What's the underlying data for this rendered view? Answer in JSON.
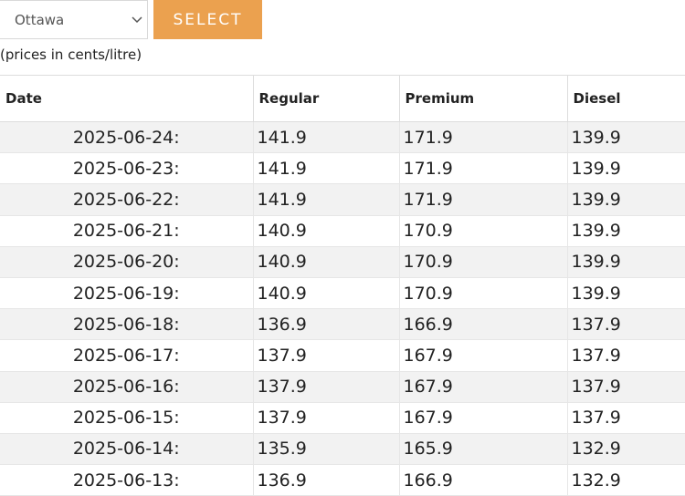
{
  "selector": {
    "city_value": "Ottawa",
    "button_label": "SELECT"
  },
  "note": "(prices in cents/litre)",
  "table": {
    "headers": {
      "date": "Date",
      "regular": "Regular",
      "premium": "Premium",
      "diesel": "Diesel"
    },
    "rows": [
      {
        "date": "2025-06-24:",
        "regular": "141.9",
        "premium": "171.9",
        "diesel": "139.9"
      },
      {
        "date": "2025-06-23:",
        "regular": "141.9",
        "premium": "171.9",
        "diesel": "139.9"
      },
      {
        "date": "2025-06-22:",
        "regular": "141.9",
        "premium": "171.9",
        "diesel": "139.9"
      },
      {
        "date": "2025-06-21:",
        "regular": "140.9",
        "premium": "170.9",
        "diesel": "139.9"
      },
      {
        "date": "2025-06-20:",
        "regular": "140.9",
        "premium": "170.9",
        "diesel": "139.9"
      },
      {
        "date": "2025-06-19:",
        "regular": "140.9",
        "premium": "170.9",
        "diesel": "139.9"
      },
      {
        "date": "2025-06-18:",
        "regular": "136.9",
        "premium": "166.9",
        "diesel": "137.9"
      },
      {
        "date": "2025-06-17:",
        "regular": "137.9",
        "premium": "167.9",
        "diesel": "137.9"
      },
      {
        "date": "2025-06-16:",
        "regular": "137.9",
        "premium": "167.9",
        "diesel": "137.9"
      },
      {
        "date": "2025-06-15:",
        "regular": "137.9",
        "premium": "167.9",
        "diesel": "137.9"
      },
      {
        "date": "2025-06-14:",
        "regular": "135.9",
        "premium": "165.9",
        "diesel": "132.9"
      },
      {
        "date": "2025-06-13:",
        "regular": "136.9",
        "premium": "166.9",
        "diesel": "132.9"
      }
    ]
  },
  "colors": {
    "accent": "#eba14f",
    "stripe": "#f2f2f2"
  }
}
